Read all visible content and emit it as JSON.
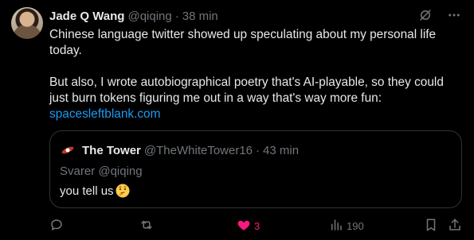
{
  "post": {
    "author_name": "Jade Q Wang",
    "author_handle": "@qiqing",
    "separator": "·",
    "time": "38 min",
    "body_para1": "Chinese language twitter showed up speculating about my personal life today.",
    "body_para2": "But also, I wrote autobiographical poetry that's AI-playable, so they could just burn tokens figuring me out in a way that's way more fun:",
    "link_text": "spacesleftblank.com"
  },
  "quote": {
    "author_name": "The Tower",
    "author_handle": "@TheWhiteTower16",
    "separator": "·",
    "time": "43 min",
    "reply_context": "Svarer @qiqing",
    "text": "you tell us"
  },
  "actions": {
    "reply_count": "",
    "repost_count": "",
    "like_count": "3",
    "views_count": "190"
  },
  "colors": {
    "background": "#000000",
    "text": "#e7e9ea",
    "muted": "#71767b",
    "link": "#1d9bf0",
    "like": "#f91880",
    "border": "#2f3336"
  },
  "icons": [
    "grok-icon",
    "more-icon",
    "reply-icon",
    "repost-icon",
    "heart-filled-icon",
    "views-icon",
    "bookmark-icon",
    "share-icon",
    "thinking-face-emoji"
  ]
}
